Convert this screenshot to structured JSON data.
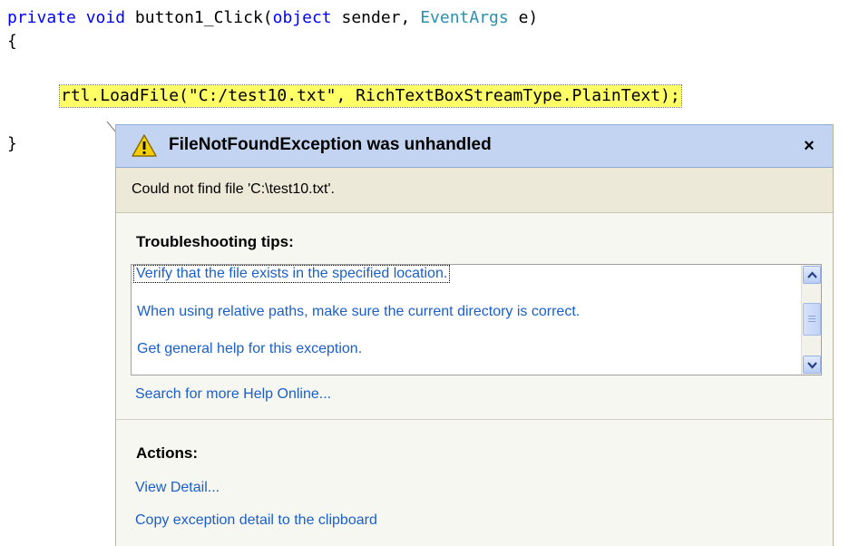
{
  "code": {
    "line1": {
      "kw_private": "private",
      "kw_void": "void",
      "method": " button1_Click(",
      "kw_object": "object",
      "sender": " sender, ",
      "type_eventargs": "EventArgs",
      "param_e": " e)"
    },
    "open_brace": "{",
    "statement": {
      "prefix": "rtl.LoadFile(",
      "string": "\"C:/test10.txt\"",
      "middle": ", ",
      "type": "RichTextBoxStreamType",
      "suffix": ".PlainText);"
    },
    "close_brace": "}"
  },
  "assistant": {
    "title": "FileNotFoundException was unhandled",
    "close": "×",
    "message": "Could not find file 'C:\\test10.txt'.",
    "troubleshooting_heading": "Troubleshooting tips:",
    "tips": [
      "Verify that the file exists in the specified location.",
      "When using relative paths, make sure the current directory is correct.",
      "Get general help for this exception."
    ],
    "search_link": "Search for more Help Online...",
    "actions_heading": "Actions:",
    "actions": [
      "View Detail...",
      "Copy exception detail to the clipboard"
    ]
  },
  "icons": {
    "warning": "warning-icon",
    "scroll_up": "chevron-up-icon",
    "scroll_down": "chevron-down-icon"
  },
  "colors": {
    "keyword": "#0000ff",
    "type": "#2b91af",
    "string": "#a31515",
    "highlight": "#ffff66",
    "link": "#1a5fc9",
    "header": "#c3d4f2"
  }
}
